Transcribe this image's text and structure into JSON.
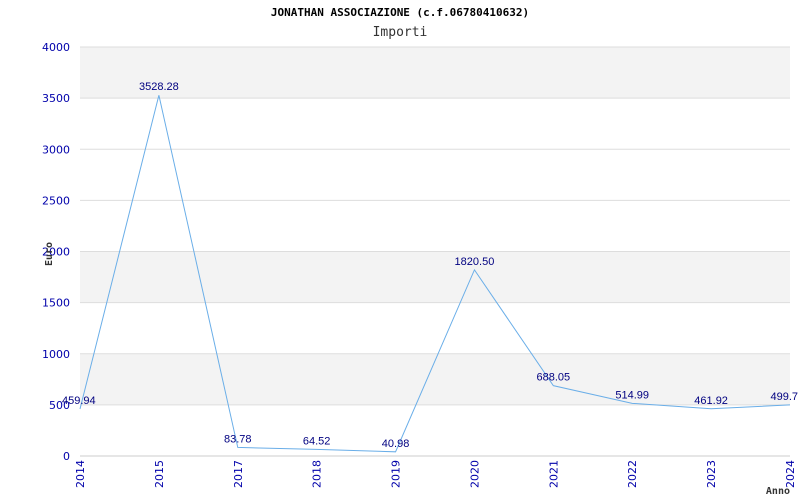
{
  "chart_data": {
    "type": "line",
    "title": "JONATHAN ASSOCIAZIONE (c.f.06780410632)",
    "subtitle": "Importi",
    "xlabel": "Anno",
    "ylabel": "Euro",
    "x": [
      "2014",
      "2015",
      "2017",
      "2018",
      "2019",
      "2020",
      "2021",
      "2022",
      "2023",
      "2024"
    ],
    "y": [
      459.94,
      3528.28,
      83.78,
      64.52,
      40.98,
      1820.5,
      688.05,
      514.99,
      461.92,
      499.7
    ],
    "data_labels": [
      "459.94",
      "3528.28",
      "83.78",
      "64.52",
      "40.98",
      "1820.50",
      "688.05",
      "514.99",
      "461.92",
      "499.7"
    ],
    "ylim": [
      0,
      4000
    ],
    "yticks": [
      0,
      500,
      1000,
      1500,
      2000,
      2500,
      3000,
      3500,
      4000
    ],
    "grid": true,
    "colors": {
      "line": "#6aaee8",
      "band": "#f3f3f3",
      "grid": "#dddddd",
      "ticks": "#0000aa",
      "labels": "#000080"
    }
  }
}
